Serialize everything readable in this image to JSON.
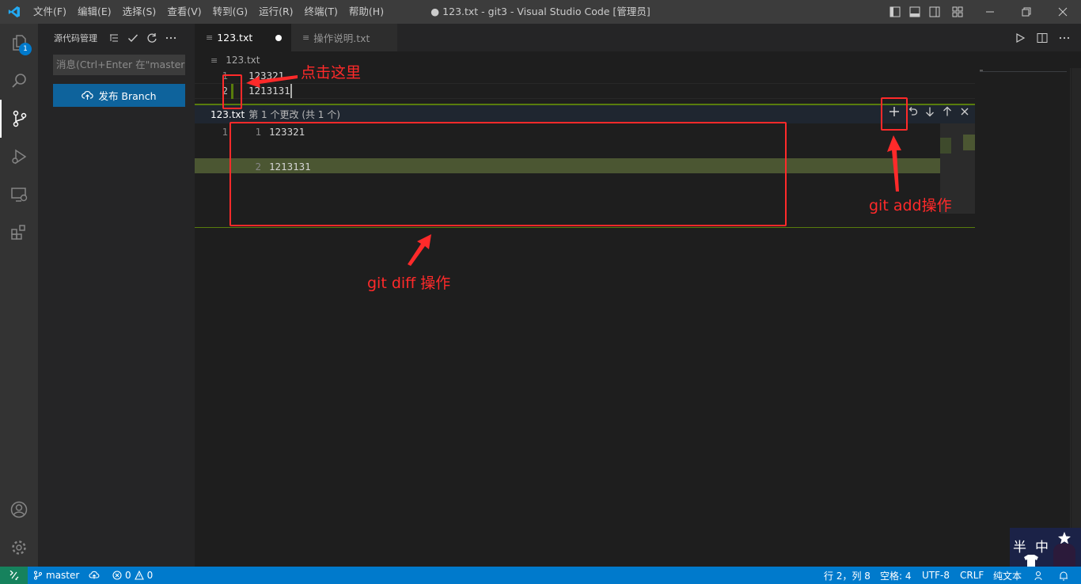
{
  "titlebar": {
    "menu": [
      "文件(F)",
      "编辑(E)",
      "选择(S)",
      "查看(V)",
      "转到(G)",
      "运行(R)",
      "终端(T)",
      "帮助(H)"
    ],
    "window_title": "● 123.txt - git3 - Visual Studio Code [管理员]"
  },
  "activitybar": {
    "scm_badge": "1"
  },
  "sidebar": {
    "title": "源代码管理",
    "message_placeholder": "消息(Ctrl+Enter 在\"master\"提交)",
    "publish_button": "发布 Branch"
  },
  "tabs": [
    {
      "label": "123.txt",
      "dirty": true
    },
    {
      "label": "操作说明.txt"
    }
  ],
  "breadcrumb": "123.txt",
  "editor": {
    "lines": [
      {
        "num": "1",
        "text": "123321"
      },
      {
        "num": "2",
        "text": "1213131"
      }
    ]
  },
  "peek": {
    "file": "123.txt",
    "description": "第 1 个更改 (共 1 个)",
    "lines": [
      {
        "orig": "1",
        "mod": "1",
        "text": "123321"
      },
      {
        "orig": "",
        "mod": "2",
        "text": "1213131"
      }
    ]
  },
  "annotations": {
    "click_here": "点击这里",
    "git_add": "git add操作",
    "git_diff": "git diff 操作"
  },
  "statusbar": {
    "branch": "master",
    "errors": "0",
    "warnings": "0",
    "position": "行 2，列 8",
    "spaces": "空格: 4",
    "encoding": "UTF-8",
    "eol": "CRLF",
    "language": "纯文本"
  },
  "corner": {
    "char1": "半",
    "char2": "中"
  }
}
